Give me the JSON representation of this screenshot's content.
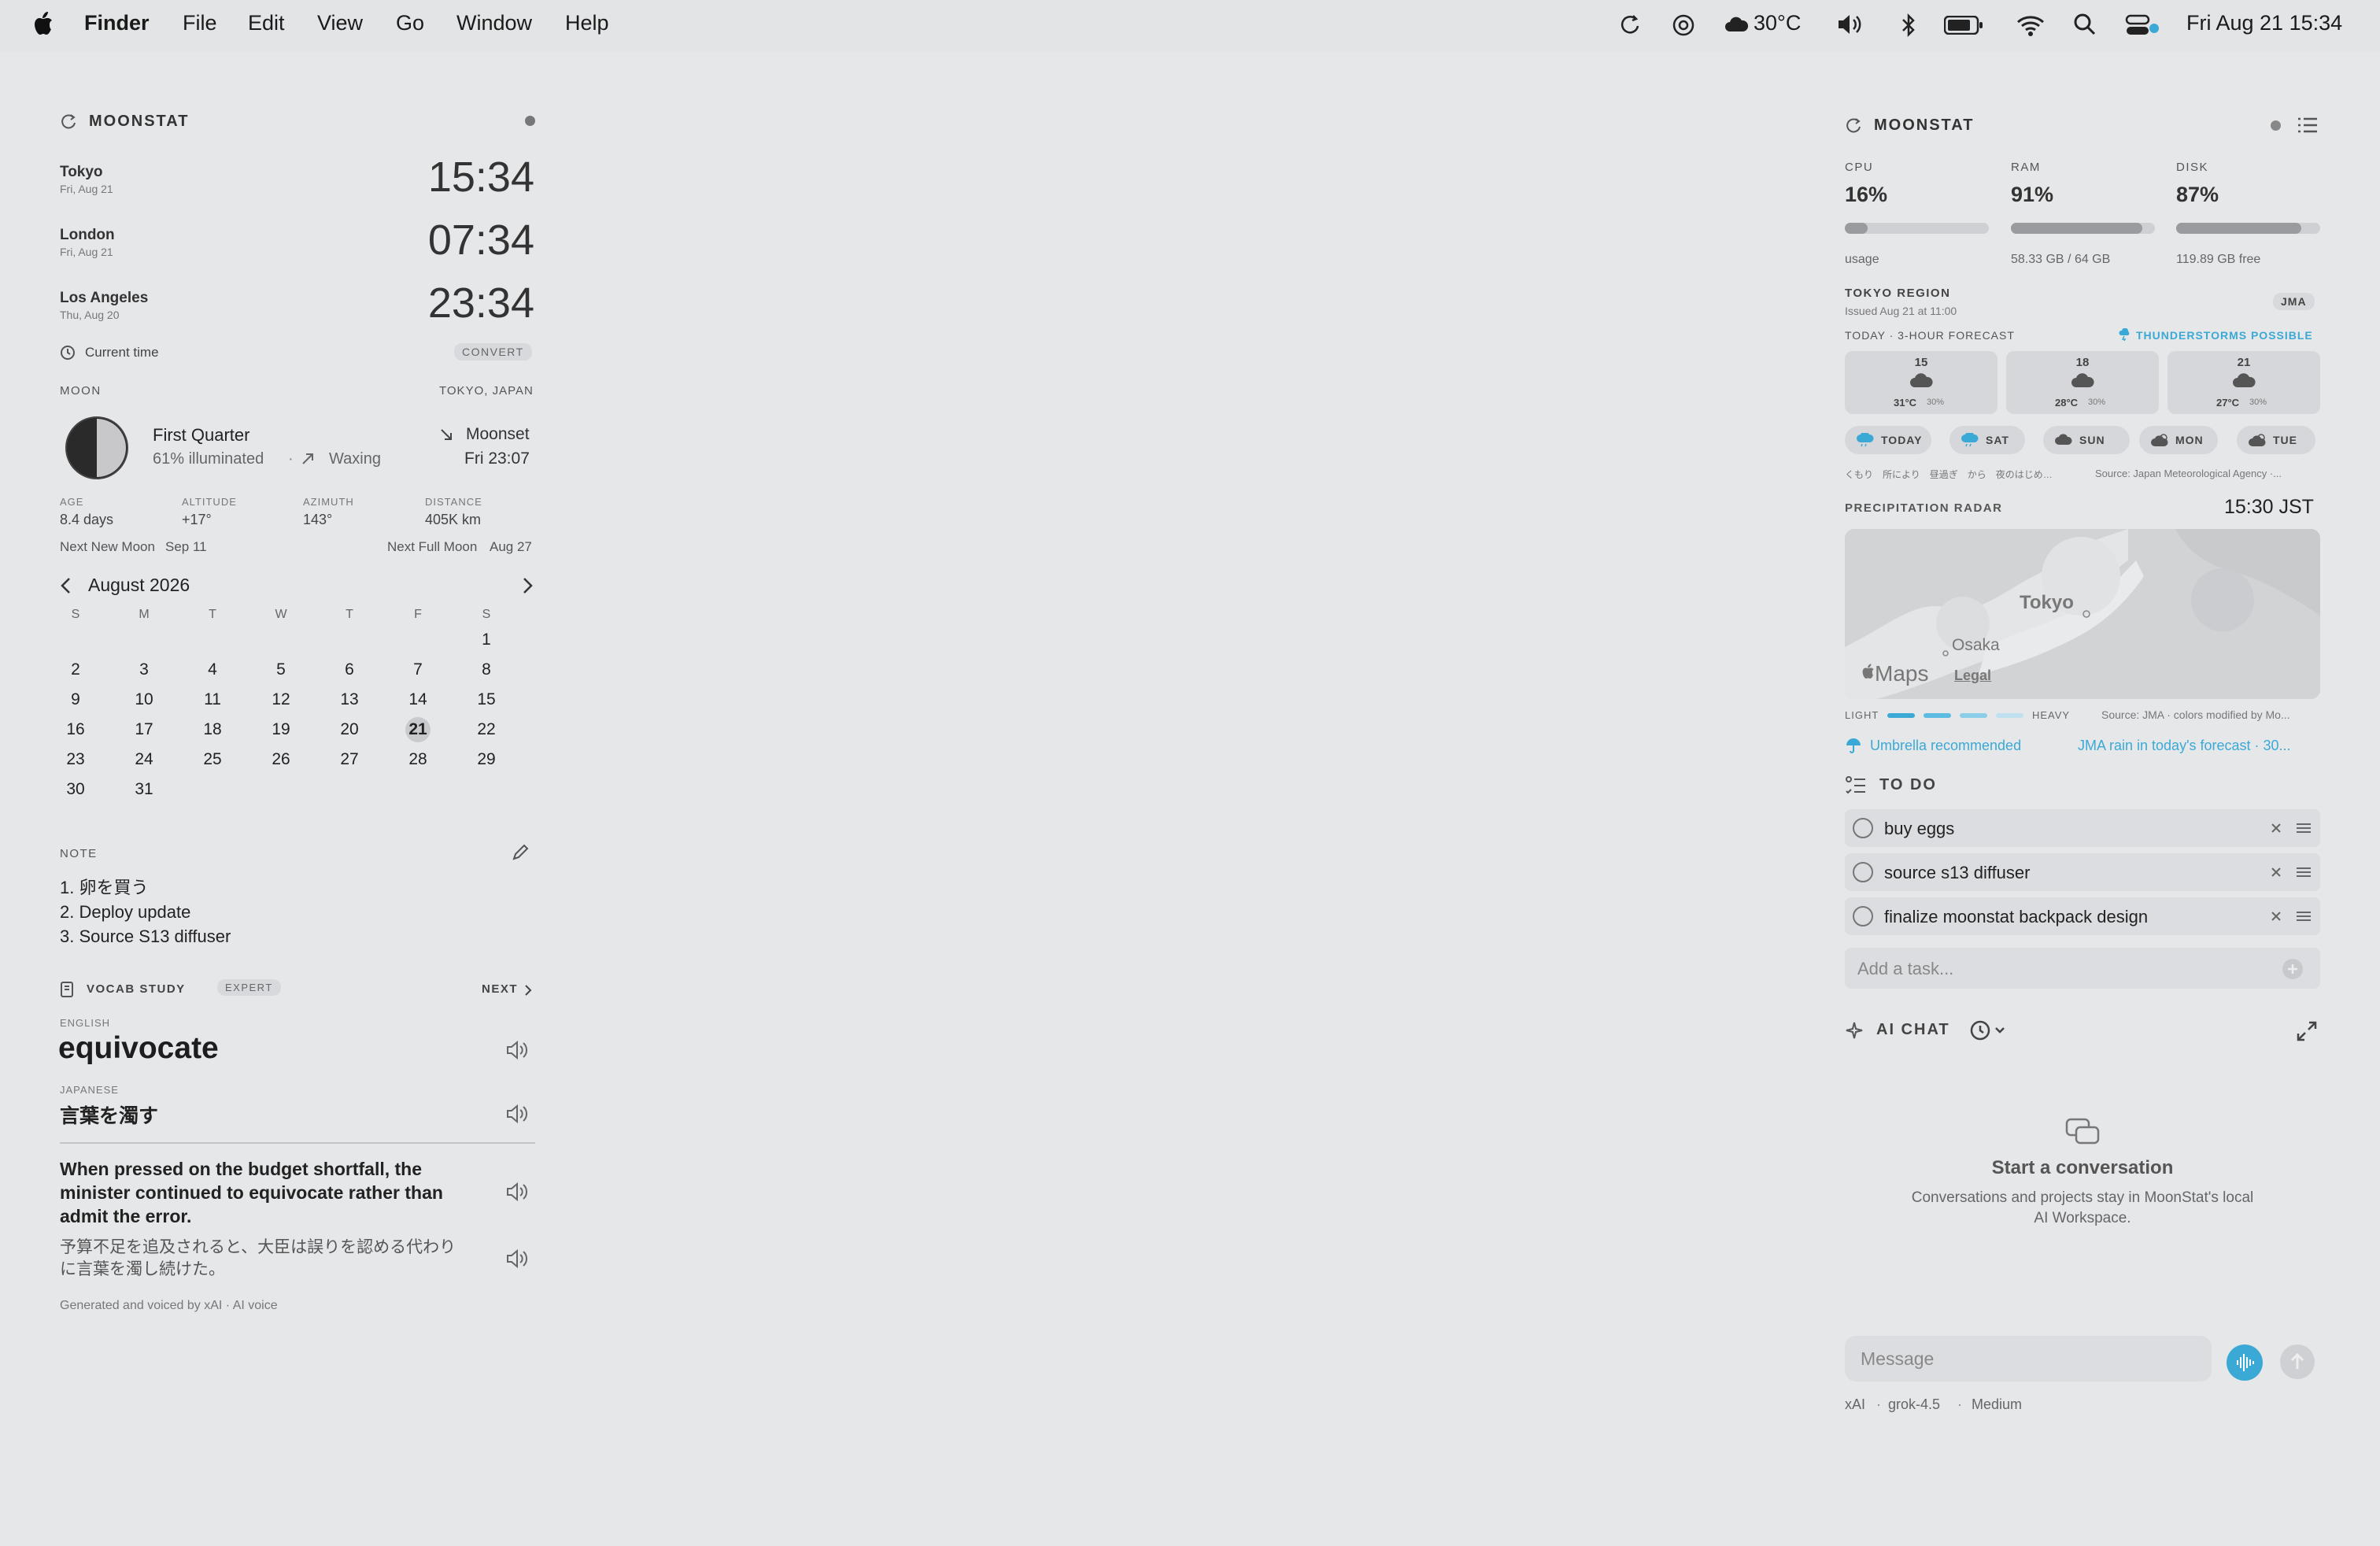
{
  "menubar": {
    "app": "Finder",
    "items": [
      "File",
      "Edit",
      "View",
      "Go",
      "Window",
      "Help"
    ],
    "temperature": "30°C",
    "datetime": "Fri Aug 21  15:34"
  },
  "left": {
    "title": "MOONSTAT",
    "clocks": [
      {
        "city": "Tokyo",
        "date": "Fri, Aug 21",
        "time": "15:34"
      },
      {
        "city": "London",
        "date": "Fri, Aug 21",
        "time": "07:34"
      },
      {
        "city": "Los Angeles",
        "date": "Thu, Aug 20",
        "time": "23:34"
      }
    ],
    "current_time_label": "Current time",
    "convert_label": "CONVERT",
    "moon": {
      "label": "MOON",
      "location": "TOKYO, JAPAN",
      "phase": "First Quarter",
      "illuminated": "61% illuminated",
      "sep": "·",
      "trend": "Waxing",
      "moonset_label": "Moonset",
      "moonset_time": "Fri 23:07",
      "illumination_fraction": 0.61,
      "stats": [
        {
          "label": "AGE",
          "value": "8.4 days"
        },
        {
          "label": "ALTITUDE",
          "value": "+17°"
        },
        {
          "label": "AZIMUTH",
          "value": "143°"
        },
        {
          "label": "DISTANCE",
          "value": "405K km"
        }
      ],
      "next_new_label": "Next New Moon",
      "next_new_date": "Sep 11",
      "next_full_label": "Next Full Moon",
      "next_full_date": "Aug 27"
    },
    "calendar": {
      "month": "August 2026",
      "weekdays": [
        "S",
        "M",
        "T",
        "W",
        "T",
        "F",
        "S"
      ],
      "weeks": [
        [
          "",
          "",
          "",
          "",
          "",
          "",
          "1"
        ],
        [
          "2",
          "3",
          "4",
          "5",
          "6",
          "7",
          "8"
        ],
        [
          "9",
          "10",
          "11",
          "12",
          "13",
          "14",
          "15"
        ],
        [
          "16",
          "17",
          "18",
          "19",
          "20",
          "21",
          "22"
        ],
        [
          "23",
          "24",
          "25",
          "26",
          "27",
          "28",
          "29"
        ],
        [
          "30",
          "31",
          "",
          "",
          "",
          "",
          ""
        ]
      ],
      "today": "21"
    },
    "note": {
      "label": "NOTE",
      "lines": [
        "1. 卵を買う",
        "2. Deploy update",
        "3. Source S13 diffuser"
      ]
    },
    "vocab": {
      "label": "VOCAB STUDY",
      "level": "EXPERT",
      "next": "NEXT",
      "english_label": "ENGLISH",
      "word": "equivocate",
      "japanese_label": "JAPANESE",
      "translation": "言葉を濁す",
      "example_en": "When pressed on the budget shortfall, the minister continued to equivocate rather than admit the error.",
      "example_ja": "予算不足を追及されると、大臣は誤りを認める代わりに言葉を濁し続けた。",
      "footer": "Generated and voiced by xAI · AI voice"
    }
  },
  "right": {
    "title": "MOONSTAT",
    "system": [
      {
        "label": "CPU",
        "value": "16%",
        "fraction": 0.16,
        "detail": "usage"
      },
      {
        "label": "RAM",
        "value": "91%",
        "fraction": 0.91,
        "detail": "58.33 GB / 64 GB"
      },
      {
        "label": "DISK",
        "value": "87%",
        "fraction": 0.87,
        "detail": "119.89 GB free"
      }
    ],
    "weather": {
      "region": "TOKYO REGION",
      "issued": "Issued Aug 21 at 11:00",
      "agency": "JMA",
      "forecast_label": "TODAY · 3-HOUR FORECAST",
      "alert": "THUNDERSTORMS POSSIBLE",
      "hourly": [
        {
          "hour": "15",
          "temp": "31°C",
          "pop": "30%"
        },
        {
          "hour": "18",
          "temp": "28°C",
          "pop": "30%"
        },
        {
          "hour": "21",
          "temp": "27°C",
          "pop": "30%"
        }
      ],
      "days": [
        "TODAY",
        "SAT",
        "SUN",
        "MON",
        "TUE"
      ],
      "summary": "くもり　所により　昼過ぎ　から　夜のはじめ…",
      "source": "Source: Japan Meteorological Agency ·..."
    },
    "radar": {
      "label": "PRECIPITATION RADAR",
      "time": "15:30 JST",
      "city1": "Tokyo",
      "city2": "Osaka",
      "maps": "Maps",
      "legal": "Legal",
      "light": "LIGHT",
      "heavy": "HEAVY",
      "source": "Source: JMA · colors modified by Mo...",
      "umbrella": "Umbrella recommended",
      "rain_note": "JMA rain in today's forecast · 30..."
    },
    "todo": {
      "label": "TO DO",
      "tasks": [
        "buy eggs",
        "source s13 diffuser",
        "finalize moonstat backpack design"
      ],
      "add_placeholder": "Add a task..."
    },
    "chat": {
      "label": "AI CHAT",
      "empty_title": "Start a conversation",
      "empty_desc_1": "Conversations and projects stay in MoonStat's local",
      "empty_desc_2": "AI Workspace.",
      "message_placeholder": "Message",
      "provider": "xAI",
      "model": "grok-4.5",
      "effort": "Medium",
      "sep": "·"
    }
  }
}
